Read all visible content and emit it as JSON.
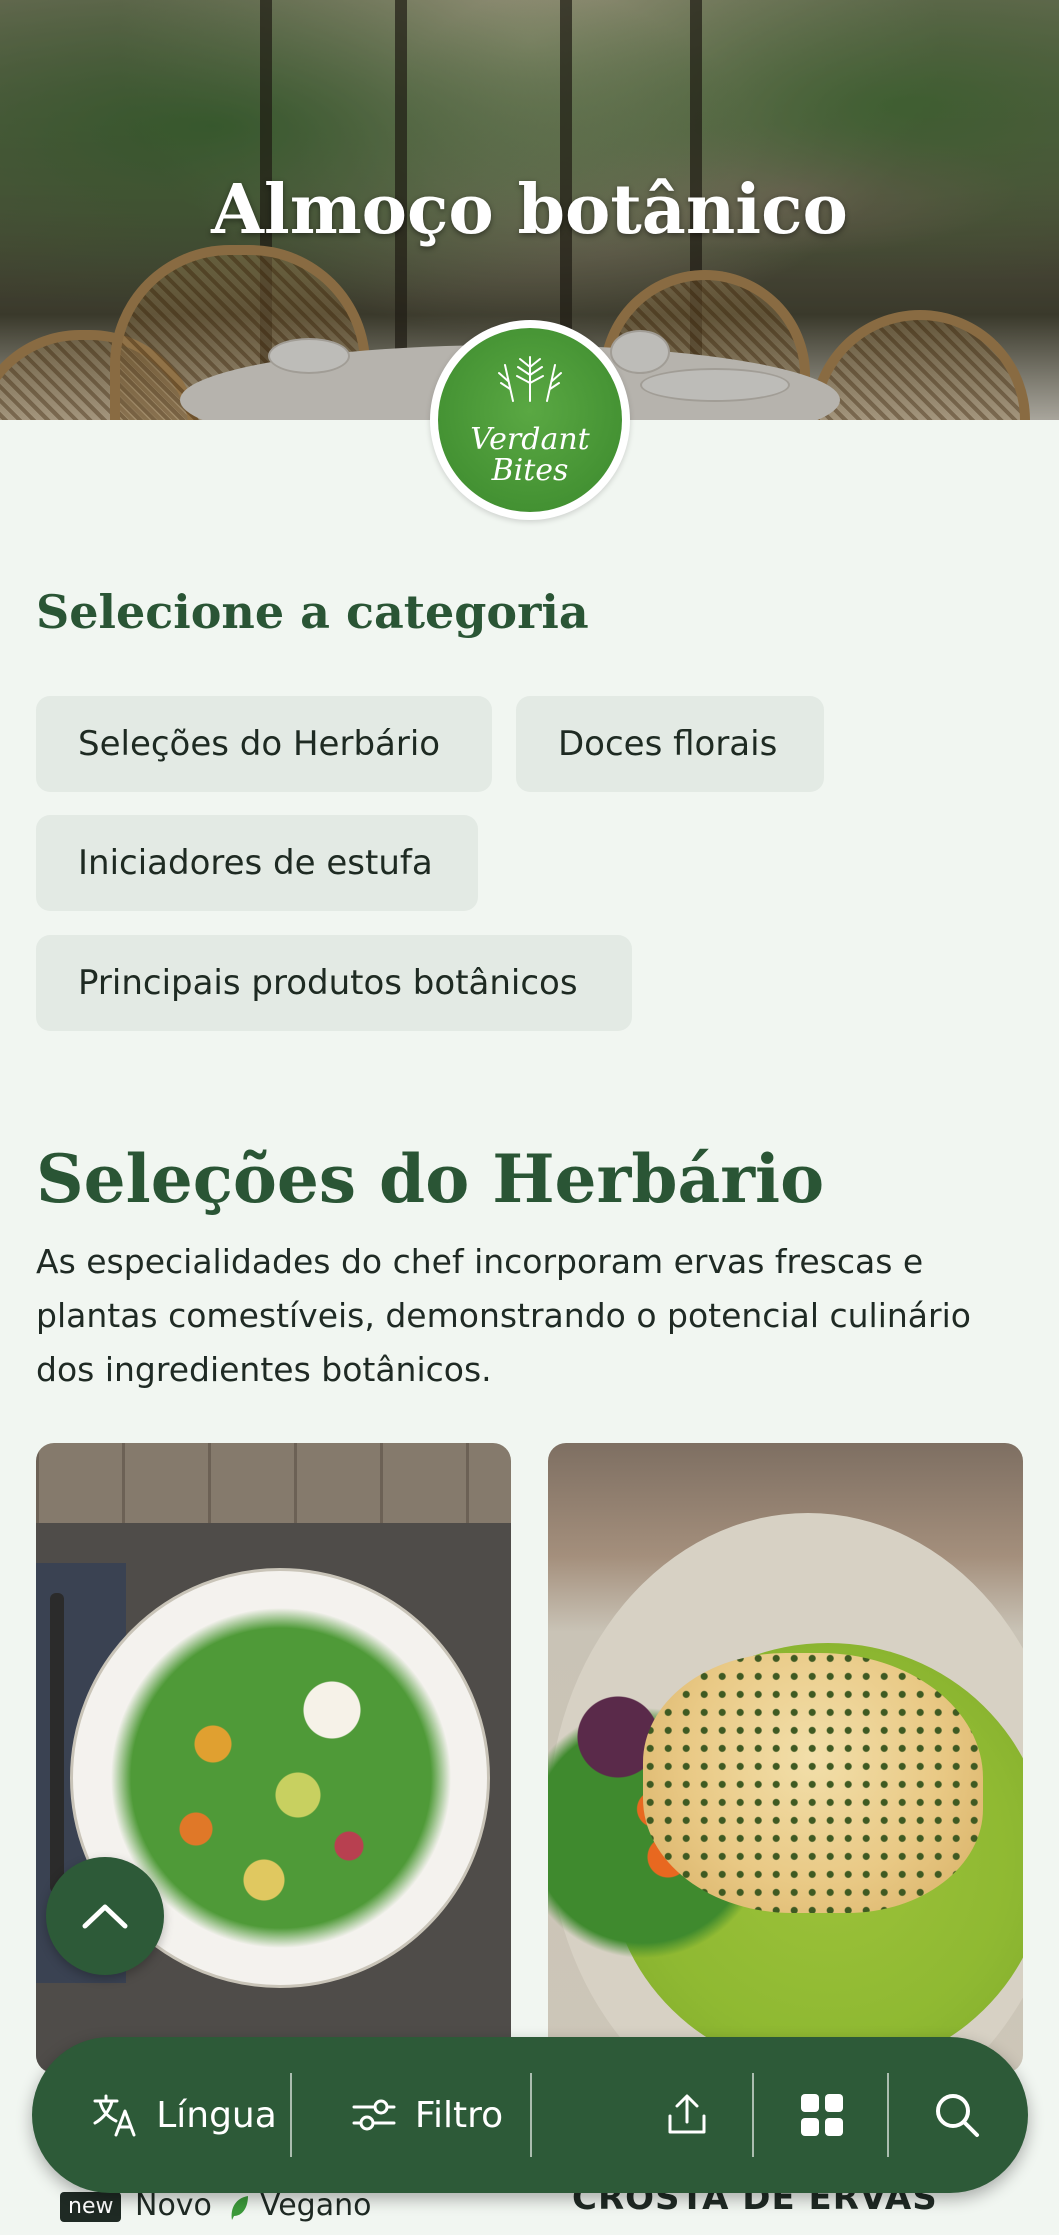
{
  "hero": {
    "title": "Almoço botânico"
  },
  "logo": {
    "line1": "Verdant",
    "line2": "Bites"
  },
  "category_section": {
    "heading": "Selecione a categoria",
    "chips": [
      "Seleções do Herbário",
      "Doces florais",
      "Iniciadores de estufa",
      "Principais produtos botânicos"
    ]
  },
  "main_section": {
    "title": "Seleções do Herbário",
    "description": "As especialidades do chef incorporam ervas frescas e plantas comestíveis, demonstrando o potencial culinário dos ingredientes botânicos."
  },
  "cards": [
    {
      "badge": "new",
      "tag_new": "Novo",
      "tag_vegan": "Vegano",
      "icon": "leaf-icon"
    },
    {
      "title": "CROSTA DE ERVAS"
    }
  ],
  "toolbar": {
    "language_label": "Língua",
    "filter_label": "Filtro",
    "icons": [
      "translate-icon",
      "filter-icon",
      "share-icon",
      "grid-icon",
      "search-icon"
    ]
  },
  "colors": {
    "primary_green": "#2d5a38",
    "heading_green": "#2a5535",
    "background": "#f1f6f1",
    "chip_background": "#e3eae4",
    "logo_green": "#449233"
  }
}
